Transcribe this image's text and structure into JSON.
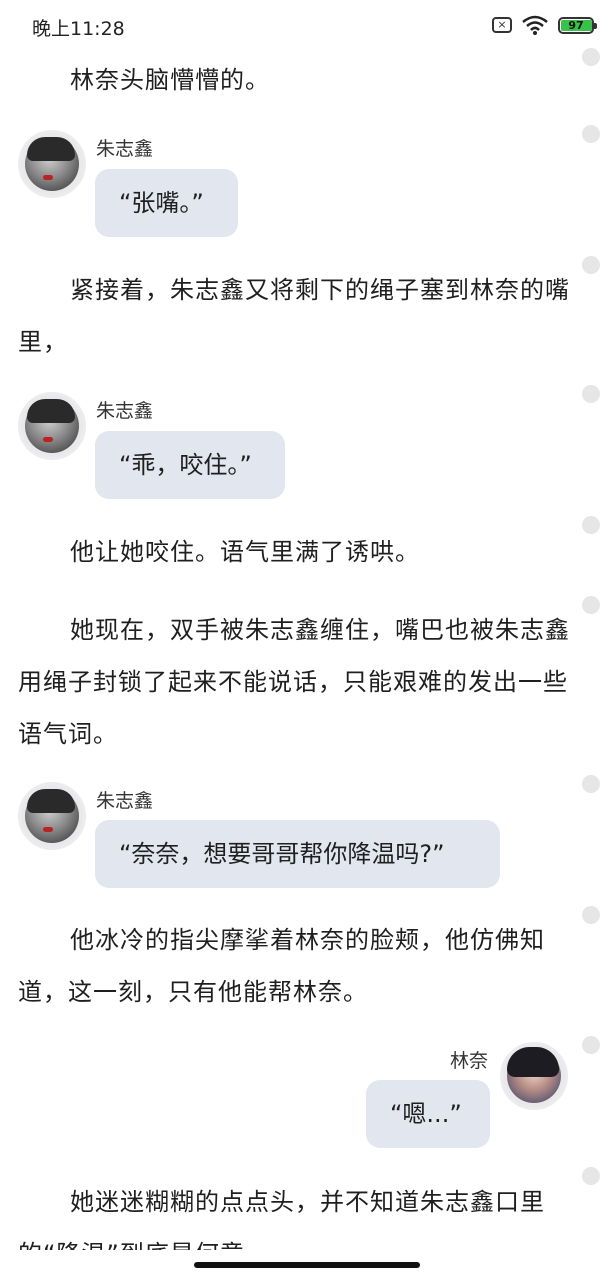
{
  "status_bar": {
    "time": "晚上11:28",
    "battery": "97",
    "sim_icon": "sim-x-icon",
    "wifi_icon": "wifi-icon"
  },
  "story": {
    "p1": "林奈头脑懵懵的。",
    "b1": {
      "speaker": "朱志鑫",
      "text": "“张嘴。”"
    },
    "p2": "紧接着，朱志鑫又将剩下的绳子塞到林奈的嘴里，",
    "b2": {
      "speaker": "朱志鑫",
      "text": "“乖，咬住。”"
    },
    "p3": "他让她咬住。语气里满了诱哄。",
    "p4": "她现在，双手被朱志鑫缠住，嘴巴也被朱志鑫用绳子封锁了起来不能说话，只能艰难的发出一些语气词。",
    "b3": {
      "speaker": "朱志鑫",
      "text": "“奈奈，想要哥哥帮你降温吗?”"
    },
    "p5": "他冰冷的指尖摩挲着林奈的脸颊，他仿佛知道，这一刻，只有他能帮林奈。",
    "b4": {
      "speaker": "林奈",
      "text": "“嗯...”"
    },
    "p6": "她迷迷糊糊的点点头，并不知道朱志鑫口里的“降温”到底是何意"
  },
  "colors": {
    "bubble": "#e1e6ef",
    "battery_fill": "#39c24a"
  }
}
